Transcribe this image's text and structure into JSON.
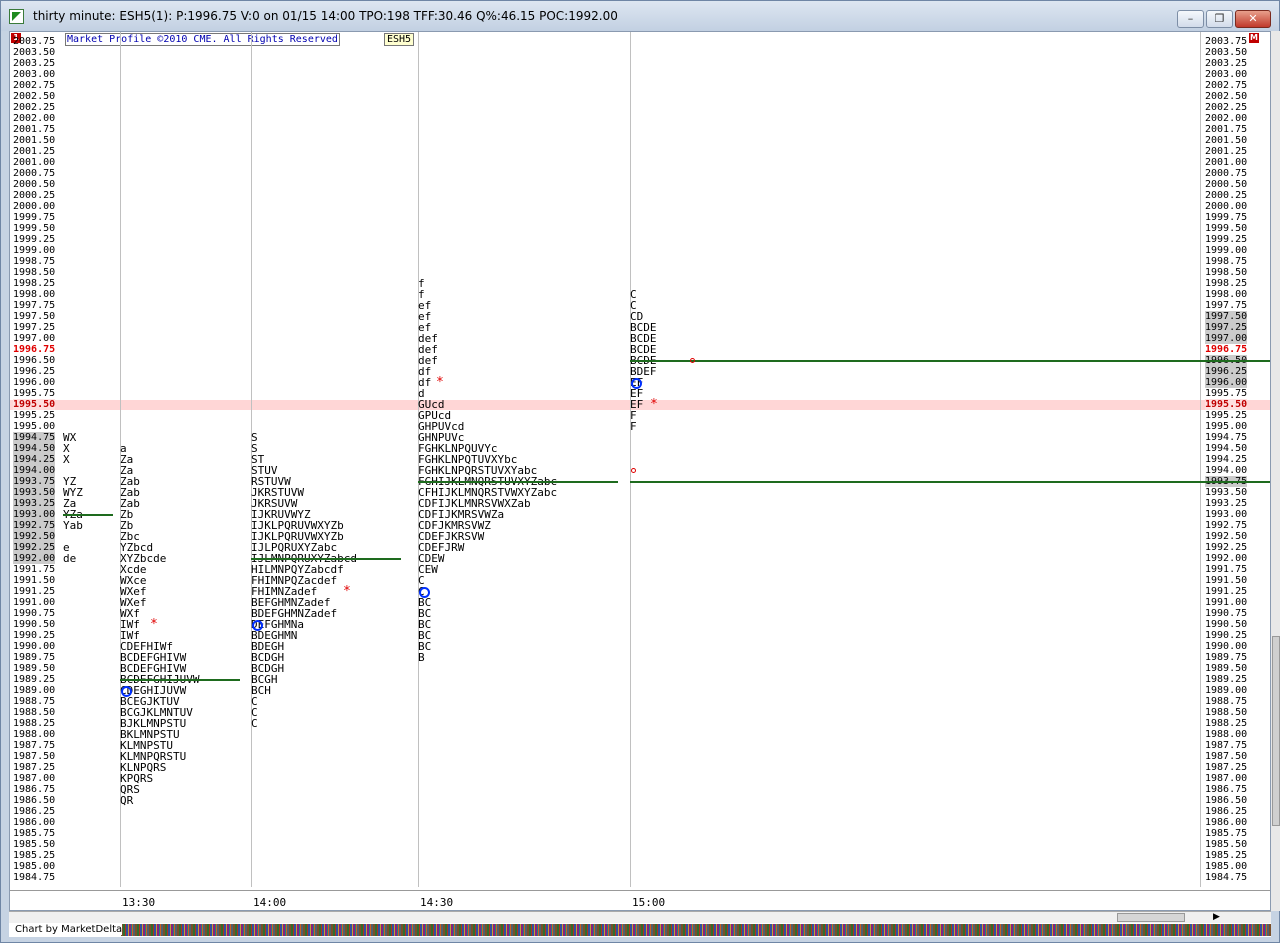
{
  "window": {
    "title": "thirty minute: ESH5(1): P:1996.75 V:0 on 01/15 14:00 TPO:198 TFF:30.46 Q%:46.15 POC:1992.00",
    "min_label": "–",
    "max_label": "❐",
    "close_label": "✕"
  },
  "banner": {
    "copyright": "Market Profile ©2010 CME. All Rights Reserved",
    "symbol": "ESH5"
  },
  "corner_left": "1",
  "corner_right": "M",
  "price_axis": {
    "top": 2003.75,
    "step": 0.25,
    "count": 77,
    "labels": [
      "2003.75",
      "2003.50",
      "2003.25",
      "2003.00",
      "2002.75",
      "2002.50",
      "2002.25",
      "2002.00",
      "2001.75",
      "2001.50",
      "2001.25",
      "2001.00",
      "2000.75",
      "2000.50",
      "2000.25",
      "2000.00",
      "1999.75",
      "1999.50",
      "1999.25",
      "1999.00",
      "1998.75",
      "1998.50",
      "1998.25",
      "1998.00",
      "1997.75",
      "1997.50",
      "1997.25",
      "1997.00",
      "1996.75",
      "1996.50",
      "1996.25",
      "1996.00",
      "1995.75",
      "1995.50",
      "1995.25",
      "1995.00",
      "1994.75",
      "1994.50",
      "1994.25",
      "1994.00",
      "1993.75",
      "1993.50",
      "1993.25",
      "1993.00",
      "1992.75",
      "1992.50",
      "1992.25",
      "1992.00",
      "1991.75",
      "1991.50",
      "1991.25",
      "1991.00",
      "1990.75",
      "1990.50",
      "1990.25",
      "1990.00",
      "1989.75",
      "1989.50",
      "1989.25",
      "1989.00",
      "1988.75",
      "1988.50",
      "1988.25",
      "1988.00",
      "1987.75",
      "1987.50",
      "1987.25",
      "1987.00",
      "1986.75",
      "1986.50",
      "1986.25",
      "1986.00",
      "1985.75",
      "1985.50",
      "1985.25",
      "1985.00",
      "1984.75"
    ],
    "left_shaded": [
      "1994.75",
      "1994.50",
      "1994.25",
      "1994.00",
      "1993.75",
      "1993.50",
      "1993.25",
      "1993.00",
      "1992.75",
      "1992.50",
      "1992.25",
      "1992.00"
    ],
    "right_shaded": [
      "1997.50",
      "1997.25",
      "1997.00",
      "1996.50",
      "1996.25",
      "1996.00",
      "1993.75"
    ],
    "current_price": "1996.75",
    "highlight_price": "1995.50",
    "current_color": "#e00000"
  },
  "time_axis": [
    "13:30",
    "14:00",
    "14:30",
    "15:00"
  ],
  "profiles": [
    {
      "name": "profile-col-0",
      "rows": [
        {
          "p": "1994.75",
          "t": "WX"
        },
        {
          "p": "1994.50",
          "t": "X"
        },
        {
          "p": "1994.25",
          "t": "X"
        },
        {
          "p": "1993.75",
          "t": "YZ"
        },
        {
          "p": "1993.50",
          "t": "WYZ"
        },
        {
          "p": "1993.25",
          "t": "Za"
        },
        {
          "p": "1993.00",
          "t": "YZa"
        },
        {
          "p": "1992.75",
          "t": "Yab"
        },
        {
          "p": "1992.25",
          "t": "e"
        },
        {
          "p": "1992.00",
          "t": "de"
        }
      ]
    },
    {
      "name": "profile-col-1330",
      "rows": [
        {
          "p": "1994.50",
          "t": "a"
        },
        {
          "p": "1994.25",
          "t": "Za"
        },
        {
          "p": "1994.00",
          "t": "Za"
        },
        {
          "p": "1993.75",
          "t": "Zab"
        },
        {
          "p": "1993.50",
          "t": "Zab"
        },
        {
          "p": "1993.25",
          "t": "Zab"
        },
        {
          "p": "1993.00",
          "t": "Zb"
        },
        {
          "p": "1992.75",
          "t": "Zb"
        },
        {
          "p": "1992.50",
          "t": "Zbc"
        },
        {
          "p": "1992.25",
          "t": "YZbcd"
        },
        {
          "p": "1992.00",
          "t": "XYZbcde"
        },
        {
          "p": "1991.75",
          "t": "Xcde"
        },
        {
          "p": "1991.50",
          "t": "WXce"
        },
        {
          "p": "1991.25",
          "t": "WXef"
        },
        {
          "p": "1991.00",
          "t": "WXef"
        },
        {
          "p": "1990.75",
          "t": "WXf"
        },
        {
          "p": "1990.50",
          "t": "IWf"
        },
        {
          "p": "1990.25",
          "t": "IWf"
        },
        {
          "p": "1990.00",
          "t": "CDEFHIWf"
        },
        {
          "p": "1989.75",
          "t": "BCDEFGHIVW"
        },
        {
          "p": "1989.50",
          "t": "BCDEFGHIVW"
        },
        {
          "p": "1989.25",
          "t": "BCDEFGHIJUVW"
        },
        {
          "p": "1989.00",
          "t": "CDEGHIJUVW"
        },
        {
          "p": "1988.75",
          "t": "BCEGJKTUV"
        },
        {
          "p": "1988.50",
          "t": "BCGJKLMNTUV"
        },
        {
          "p": "1988.25",
          "t": "BJKLMNPSTU"
        },
        {
          "p": "1988.00",
          "t": "BKLMNPSTU"
        },
        {
          "p": "1987.75",
          "t": "KLMNPSTU"
        },
        {
          "p": "1987.50",
          "t": "KLMNPQRSTU"
        },
        {
          "p": "1987.25",
          "t": "KLNPQRS"
        },
        {
          "p": "1987.00",
          "t": "KPQRS"
        },
        {
          "p": "1986.75",
          "t": "QRS"
        },
        {
          "p": "1986.50",
          "t": "QR"
        }
      ]
    },
    {
      "name": "profile-col-1400",
      "rows": [
        {
          "p": "1994.75",
          "t": "S"
        },
        {
          "p": "1994.50",
          "t": "S"
        },
        {
          "p": "1994.25",
          "t": "ST"
        },
        {
          "p": "1994.00",
          "t": "STUV"
        },
        {
          "p": "1993.75",
          "t": "RSTUVW"
        },
        {
          "p": "1993.50",
          "t": "JKRSTUVW"
        },
        {
          "p": "1993.25",
          "t": "JKRSUVW"
        },
        {
          "p": "1993.00",
          "t": "IJKRUVWYZ"
        },
        {
          "p": "1992.75",
          "t": "IJKLPQRUVWXYZb"
        },
        {
          "p": "1992.50",
          "t": "IJKLPQRUVWXYZb"
        },
        {
          "p": "1992.25",
          "t": "IJLPQRUXYZabc"
        },
        {
          "p": "1992.00",
          "t": "IJLMNPQRUXYZabcd"
        },
        {
          "p": "1991.75",
          "t": "HILMNPQYZabcdf"
        },
        {
          "p": "1991.50",
          "t": "FHIMNPQZacdef"
        },
        {
          "p": "1991.25",
          "t": "FHIMNZadef"
        },
        {
          "p": "1991.00",
          "t": "BEFGHMNZadef"
        },
        {
          "p": "1990.75",
          "t": "BDEFGHMNZadef"
        },
        {
          "p": "1990.50",
          "t": "DEFGHMNa"
        },
        {
          "p": "1990.25",
          "t": "BDEGHMN"
        },
        {
          "p": "1990.00",
          "t": "BDEGH"
        },
        {
          "p": "1989.75",
          "t": "BCDGH"
        },
        {
          "p": "1989.50",
          "t": "BCDGH"
        },
        {
          "p": "1989.25",
          "t": "BCGH"
        },
        {
          "p": "1989.00",
          "t": "BCH"
        },
        {
          "p": "1988.75",
          "t": "C"
        },
        {
          "p": "1988.50",
          "t": "C"
        },
        {
          "p": "1988.25",
          "t": "C"
        }
      ]
    },
    {
      "name": "profile-col-1430",
      "rows": [
        {
          "p": "1998.25",
          "t": "f"
        },
        {
          "p": "1998.00",
          "t": "f"
        },
        {
          "p": "1997.75",
          "t": "ef"
        },
        {
          "p": "1997.50",
          "t": "ef"
        },
        {
          "p": "1997.25",
          "t": "ef"
        },
        {
          "p": "1997.00",
          "t": "def"
        },
        {
          "p": "1996.75",
          "t": "def"
        },
        {
          "p": "1996.50",
          "t": "def"
        },
        {
          "p": "1996.25",
          "t": "df"
        },
        {
          "p": "1996.00",
          "t": "df"
        },
        {
          "p": "1995.75",
          "t": "d"
        },
        {
          "p": "1995.50",
          "t": "GUcd"
        },
        {
          "p": "1995.25",
          "t": "GPUcd"
        },
        {
          "p": "1995.00",
          "t": "GHPUVcd"
        },
        {
          "p": "1994.75",
          "t": "GHNPUVc"
        },
        {
          "p": "1994.50",
          "t": "FGHKLNPQUVYc"
        },
        {
          "p": "1994.25",
          "t": "FGHKLNPQTUVXYbc"
        },
        {
          "p": "1994.00",
          "t": "FGHKLNPQRSTUVXYabc"
        },
        {
          "p": "1993.75",
          "t": "FGHIJKLMNQRSTUVXYZabc"
        },
        {
          "p": "1993.50",
          "t": "CFHIJKLMNQRSTVWXYZabc"
        },
        {
          "p": "1993.25",
          "t": "CDFIJKLMNRSVWXZab"
        },
        {
          "p": "1993.00",
          "t": "CDFIJKMRSVWZa"
        },
        {
          "p": "1992.75",
          "t": "CDFJKMRSVWZ"
        },
        {
          "p": "1992.50",
          "t": "CDEFJKRSVW"
        },
        {
          "p": "1992.25",
          "t": "CDEFJRW"
        },
        {
          "p": "1992.00",
          "t": "CDEW"
        },
        {
          "p": "1991.75",
          "t": "CEW"
        },
        {
          "p": "1991.50",
          "t": "C"
        },
        {
          "p": "1991.25",
          "t": "C"
        },
        {
          "p": "1991.00",
          "t": "BC"
        },
        {
          "p": "1990.75",
          "t": "BC"
        },
        {
          "p": "1990.50",
          "t": "BC"
        },
        {
          "p": "1990.25",
          "t": "BC"
        },
        {
          "p": "1990.00",
          "t": "BC"
        },
        {
          "p": "1989.75",
          "t": "B"
        }
      ]
    },
    {
      "name": "profile-col-1500",
      "rows": [
        {
          "p": "1998.00",
          "t": "C"
        },
        {
          "p": "1997.75",
          "t": "C"
        },
        {
          "p": "1997.50",
          "t": "CD"
        },
        {
          "p": "1997.25",
          "t": "BCDE"
        },
        {
          "p": "1997.00",
          "t": "BCDE"
        },
        {
          "p": "1996.75",
          "t": "BCDE"
        },
        {
          "p": "1996.50",
          "t": "BCDE"
        },
        {
          "p": "1996.25",
          "t": "BDEF"
        },
        {
          "p": "1996.00",
          "t": "EF"
        },
        {
          "p": "1995.75",
          "t": "EF"
        },
        {
          "p": "1995.50",
          "t": "EF"
        },
        {
          "p": "1995.25",
          "t": "F"
        },
        {
          "p": "1995.00",
          "t": "F"
        }
      ]
    }
  ],
  "status": {
    "label": "Chart by MarketDelta"
  },
  "colors": {
    "poc_line": "#1e6b1e",
    "marker_red": "#e00000",
    "open_circle": "#0030ff",
    "highlight_row": "#ffd6d6"
  }
}
